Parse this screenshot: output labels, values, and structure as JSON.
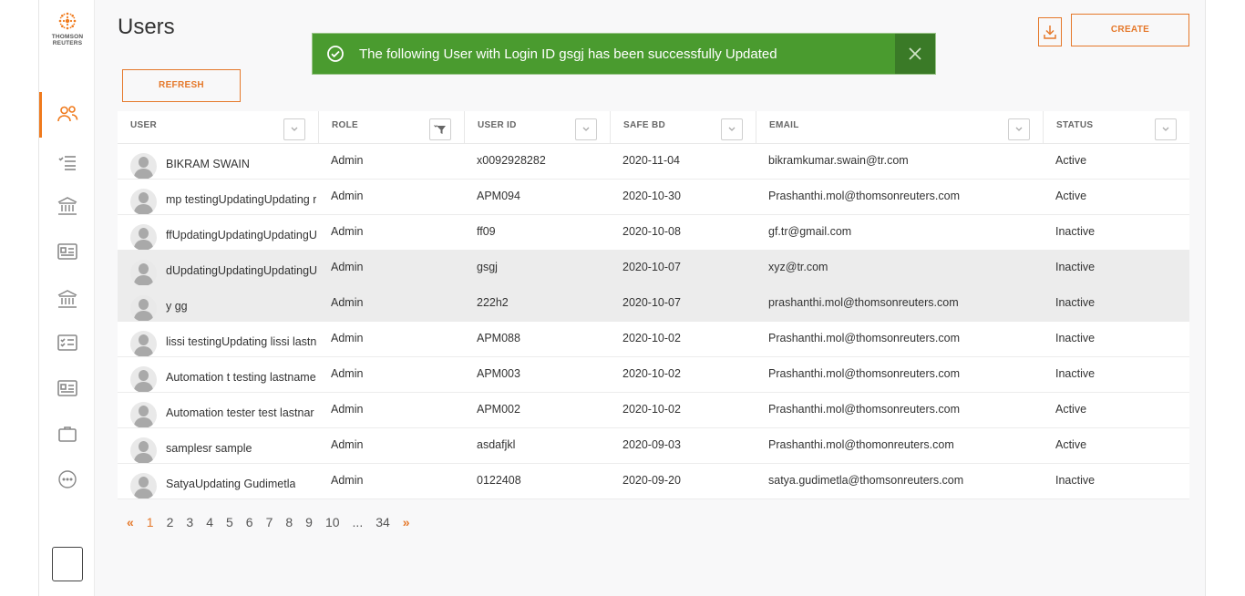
{
  "brand": {
    "line1": "THOMSON",
    "line2": "REUTERS",
    "color": "#f07a1c"
  },
  "sidebar": {
    "items": [
      {
        "icon": "users-icon",
        "active": true
      },
      {
        "icon": "list-icon"
      },
      {
        "icon": "bank-icon"
      },
      {
        "icon": "id-card-icon"
      },
      {
        "icon": "bank-icon"
      },
      {
        "icon": "checklist-icon"
      },
      {
        "icon": "id-card-icon"
      },
      {
        "icon": "briefcase-icon"
      },
      {
        "icon": "more-icon"
      }
    ]
  },
  "page": {
    "title": "Users"
  },
  "toolbar": {
    "refresh_label": "REFRESH",
    "create_label": "CREATE",
    "download_icon": "download-icon"
  },
  "toast": {
    "message": "The following User with Login ID gsgj has been successfully Updated",
    "bg": "#4a9b2f"
  },
  "table": {
    "columns": [
      "USER",
      "ROLE",
      "USER ID",
      "SAFE BD",
      "EMAIL",
      "STATUS"
    ],
    "rows": [
      {
        "user": "BIKRAM SWAIN",
        "role": "Admin",
        "user_id": "x0092928282",
        "safe_bd": "2020-11-04",
        "email": "bikramkumar.swain@tr.com",
        "status": "Active"
      },
      {
        "user": "mp testingUpdatingUpdating r",
        "role": "Admin",
        "user_id": "APM094",
        "safe_bd": "2020-10-30",
        "email": "Prashanthi.mol@thomsonreuters.com",
        "status": "Active"
      },
      {
        "user": "ffUpdatingUpdatingUpdatingU",
        "role": "Admin",
        "user_id": "ff09",
        "safe_bd": "2020-10-08",
        "email": "gf.tr@gmail.com",
        "status": "Inactive"
      },
      {
        "user": "dUpdatingUpdatingUpdatingU",
        "role": "Admin",
        "user_id": "gsgj",
        "safe_bd": "2020-10-07",
        "email": "xyz@tr.com",
        "status": "Inactive"
      },
      {
        "user": "y gg",
        "role": "Admin",
        "user_id": "222h2",
        "safe_bd": "2020-10-07",
        "email": "prashanthi.mol@thomsonreuters.com",
        "status": "Inactive"
      },
      {
        "user": "lissi testingUpdating lissi lastn",
        "role": "Admin",
        "user_id": "APM088",
        "safe_bd": "2020-10-02",
        "email": "Prashanthi.mol@thomsonreuters.com",
        "status": "Inactive"
      },
      {
        "user": "Automation t testing lastname",
        "role": "Admin",
        "user_id": "APM003",
        "safe_bd": "2020-10-02",
        "email": "Prashanthi.mol@thomsonreuters.com",
        "status": "Inactive"
      },
      {
        "user": "Automation tester test lastnar",
        "role": "Admin",
        "user_id": "APM002",
        "safe_bd": "2020-10-02",
        "email": "Prashanthi.mol@thomsonreuters.com",
        "status": "Active"
      },
      {
        "user": "samplesr sample",
        "role": "Admin",
        "user_id": "asdafjkl",
        "safe_bd": "2020-09-03",
        "email": "Prashanthi.mol@thomonreuters.com",
        "status": "Active"
      },
      {
        "user": "SatyaUpdating Gudimetla",
        "role": "Admin",
        "user_id": "0122408",
        "safe_bd": "2020-09-20",
        "email": "satya.gudimetla@thomsonreuters.com",
        "status": "Inactive"
      }
    ]
  },
  "pagination": {
    "prev": "«",
    "pages": [
      "1",
      "2",
      "3",
      "4",
      "5",
      "6",
      "7",
      "8",
      "9",
      "10",
      "...",
      "34"
    ],
    "next": "»",
    "current": "1"
  }
}
